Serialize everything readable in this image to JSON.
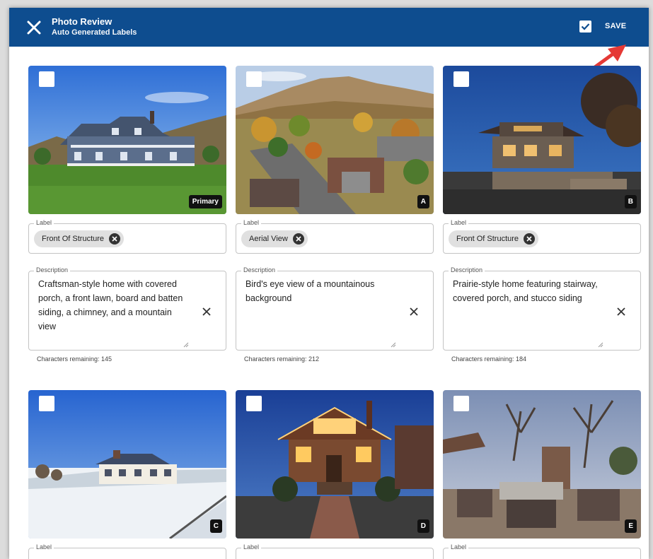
{
  "header": {
    "title": "Photo Review",
    "subtitle": "Auto Generated Labels",
    "save_label": "SAVE"
  },
  "colors": {
    "header_bg": "#0e4d8f",
    "arrow": "#e53935",
    "chip_bg": "#e0e0e0"
  },
  "icons": {
    "close": "close-icon",
    "select_all": "checkbox-checked-icon",
    "chip_remove": "cancel-circle-icon",
    "clear": "clear-icon"
  },
  "labels": {
    "label_legend": "Label",
    "description_legend": "Description"
  },
  "cards": [
    {
      "badge": "Primary",
      "label": "Front Of Structure",
      "description": "Craftsman-style home with covered porch, a front lawn, board and batten siding, a chimney, and a mountain view",
      "remaining": "Characters remaining: 145"
    },
    {
      "badge": "A",
      "label": "Aerial View",
      "description": "Bird's eye view of a mountainous background",
      "remaining": "Characters remaining: 212"
    },
    {
      "badge": "B",
      "label": "Front Of Structure",
      "description": "Prairie-style home featuring stairway, covered porch, and stucco siding",
      "remaining": "Characters remaining: 184"
    },
    {
      "badge": "C"
    },
    {
      "badge": "D"
    },
    {
      "badge": "E"
    }
  ]
}
